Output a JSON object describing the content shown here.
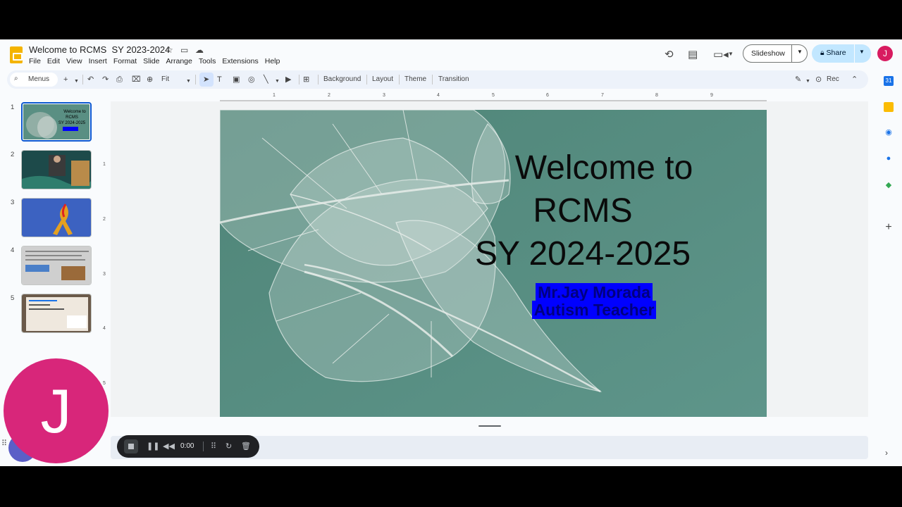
{
  "header": {
    "title": "Welcome to RCMS  SY 2023-2024",
    "menus": [
      "File",
      "Edit",
      "View",
      "Insert",
      "Format",
      "Slide",
      "Arrange",
      "Tools",
      "Extensions",
      "Help"
    ],
    "slideshow_label": "Slideshow",
    "share_label": "Share",
    "avatar_letter": "J"
  },
  "toolbar": {
    "search_label": "Menus",
    "zoom_label": "Fit",
    "background_label": "Background",
    "layout_label": "Layout",
    "theme_label": "Theme",
    "transition_label": "Transition",
    "rec_label": "Rec"
  },
  "filmstrip": {
    "slides": [
      {
        "number": "1",
        "text": "Welcome to RCMS SY 2024-2025"
      },
      {
        "number": "2"
      },
      {
        "number": "3"
      },
      {
        "number": "4"
      },
      {
        "number": "5"
      }
    ]
  },
  "ruler": {
    "h": [
      "1",
      "2",
      "3",
      "4",
      "5",
      "6",
      "7",
      "8",
      "9"
    ],
    "v": [
      "1",
      "2",
      "3",
      "4",
      "5"
    ]
  },
  "slide": {
    "title_line1": "Welcome to",
    "title_line2": "RCMS",
    "title_line3": "SY 2024-2025",
    "subtitle_line1": "Mr.Jay Morada",
    "subtitle_line2": "Autism Teacher"
  },
  "recorder": {
    "time": "0:00",
    "avatar_letter": "J"
  },
  "colors": {
    "accent": "#0b57d0",
    "share_bg": "#c2e7ff",
    "avatar": "#d81b60",
    "slide_bg": "#5a8f83",
    "highlight": "#0000ff"
  }
}
